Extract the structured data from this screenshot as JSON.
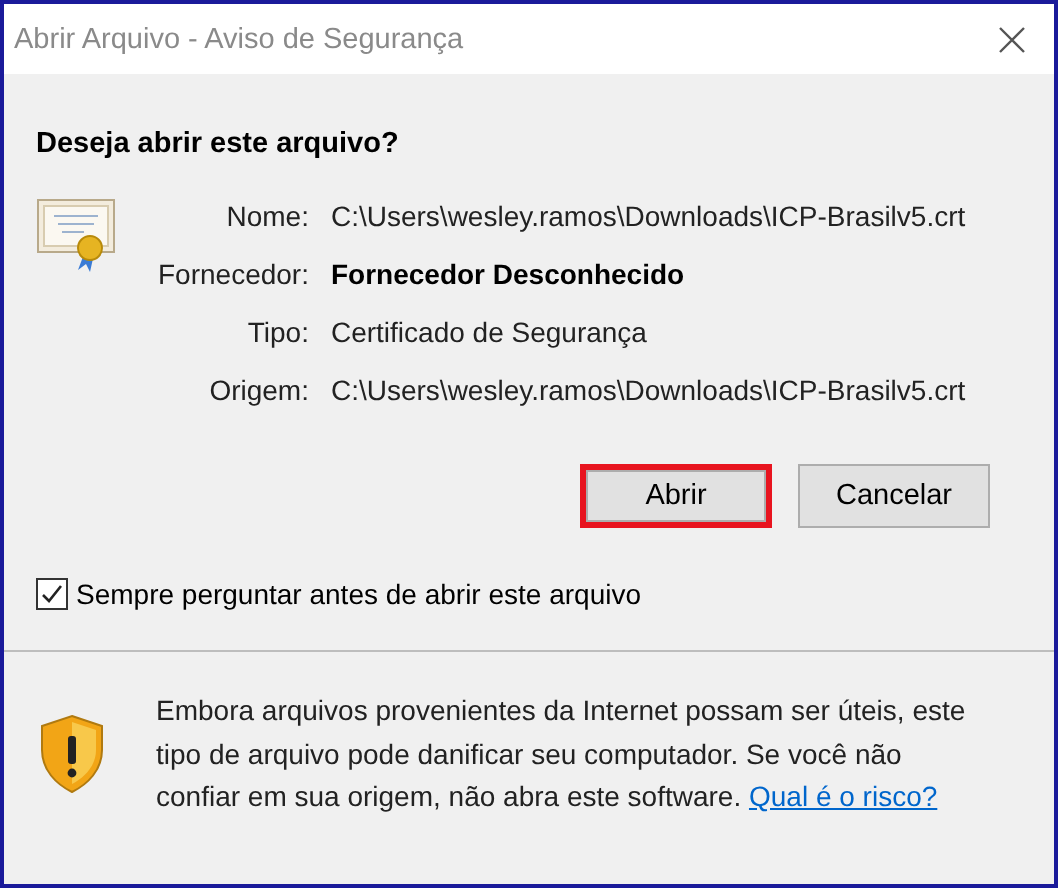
{
  "window": {
    "title": "Abrir Arquivo - Aviso de Segurança"
  },
  "heading": "Deseja abrir este arquivo?",
  "details": [
    {
      "label": "Nome:",
      "value": "C:\\Users\\wesley.ramos\\Downloads\\ICP-Brasilv5.crt",
      "bold": false
    },
    {
      "label": "Fornecedor:",
      "value": "Fornecedor Desconhecido",
      "bold": true
    },
    {
      "label": "Tipo:",
      "value": "Certificado de Segurança",
      "bold": false
    },
    {
      "label": "Origem:",
      "value": "C:\\Users\\wesley.ramos\\Downloads\\ICP-Brasilv5.crt",
      "bold": false
    }
  ],
  "buttons": [
    {
      "label": "Abrir",
      "highlighted": true
    },
    {
      "label": "Cancelar",
      "highlighted": false
    }
  ],
  "checkbox": {
    "label": "Sempre perguntar antes de abrir este arquivo",
    "checked": true
  },
  "warning": {
    "text": "Embora arquivos provenientes da Internet possam ser úteis, este tipo de arquivo pode danificar seu computador. Se você não confiar em sua origem, não abra este software.",
    "link": "Qual é o risco?"
  }
}
